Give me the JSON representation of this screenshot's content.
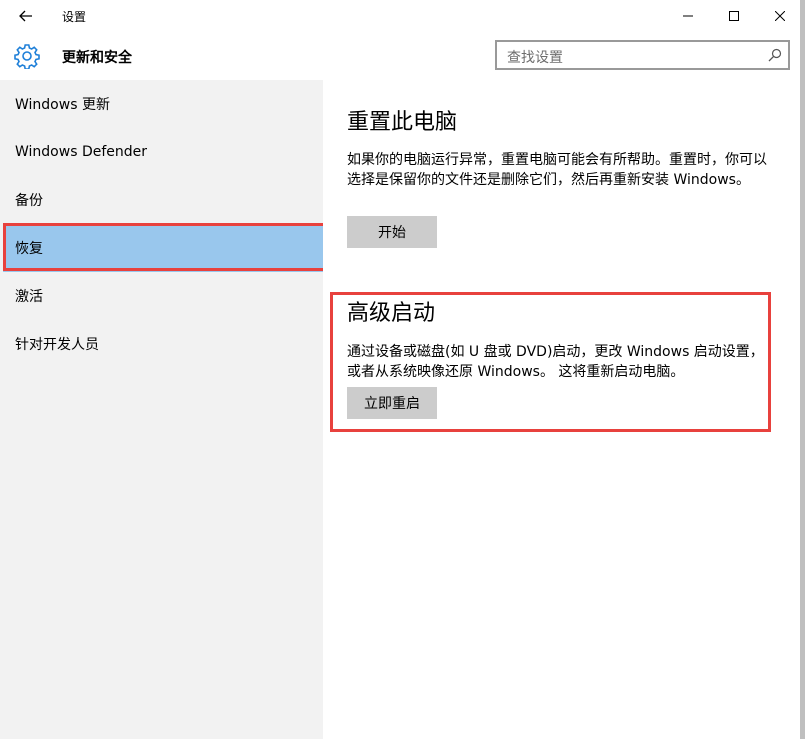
{
  "window": {
    "title": "设置",
    "back_icon": "back-arrow-icon",
    "controls": [
      "minimize-icon",
      "maximize-icon",
      "close-icon"
    ]
  },
  "header": {
    "section_title": "更新和安全",
    "icon": "gear-icon",
    "search_placeholder": "查找设置"
  },
  "sidebar": {
    "items": [
      {
        "label": "Windows 更新"
      },
      {
        "label": "Windows Defender"
      },
      {
        "label": "备份"
      },
      {
        "label": "恢复",
        "selected": true
      },
      {
        "label": "激活"
      },
      {
        "label": "针对开发人员"
      }
    ]
  },
  "main": {
    "reset": {
      "title": "重置此电脑",
      "description": "如果你的电脑运行异常，重置电脑可能会有所帮助。重置时，你可以选择是保留你的文件还是删除它们，然后再重新安装 Windows。",
      "button": "开始"
    },
    "advanced": {
      "title": "高级启动",
      "description": "通过设备或磁盘(如 U 盘或 DVD)启动，更改 Windows 启动设置，或者从系统映像还原 Windows。 这将重新启动电脑。",
      "button": "立即重启"
    }
  },
  "colors": {
    "accent": "#1e7fd8",
    "selected_bg": "#99c7ed",
    "highlight_border": "#e8413d",
    "sidebar_bg": "#f2f2f2",
    "button_bg": "#cccccc"
  }
}
